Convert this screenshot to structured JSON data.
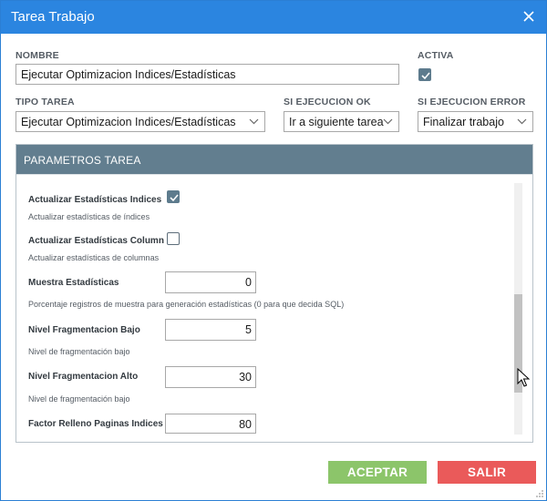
{
  "window": {
    "title": "Tarea Trabajo"
  },
  "form": {
    "nombre_label": "NOMBRE",
    "nombre_value": "Ejecutar Optimizacion Indices/Estadísticas",
    "activa_label": "ACTIVA",
    "activa_checked": true,
    "tipo_label": "TIPO TAREA",
    "tipo_value": "Ejecutar Optimizacion Indices/Estadísticas",
    "ok_label": "SI EJECUCION OK",
    "ok_value": "Ir a siguiente tarea",
    "error_label": "SI EJECUCION ERROR",
    "error_value": "Finalizar trabajo"
  },
  "params": {
    "header": "PARAMETROS TAREA",
    "items": [
      {
        "label": "Actualizar Estadísticas Indices",
        "desc": "Actualizar estadísticas de índices",
        "checked": true
      },
      {
        "label": "Actualizar Estadísticas Column",
        "desc": "Actualizar estadísticas de columnas",
        "checked": false
      },
      {
        "label": "Muestra Estadísticas",
        "value": "0",
        "desc": "Porcentaje registros de muestra para generación estadísticas (0 para que decida SQL)"
      },
      {
        "label": "Nivel Fragmentacion Bajo",
        "value": "5",
        "desc": "Nivel de fragmentación bajo"
      },
      {
        "label": "Nivel Fragmentacion Alto",
        "value": "30",
        "desc": "Nivel de fragmentación bajo"
      },
      {
        "label": "Factor Relleno Paginas Indices",
        "value": "80"
      }
    ]
  },
  "buttons": {
    "accept": "ACEPTAR",
    "exit": "SALIR"
  },
  "colors": {
    "titlebar": "#2b85e0",
    "panel_header": "#627e8f",
    "accept": "#8cc56a",
    "exit": "#ea5a5a"
  }
}
